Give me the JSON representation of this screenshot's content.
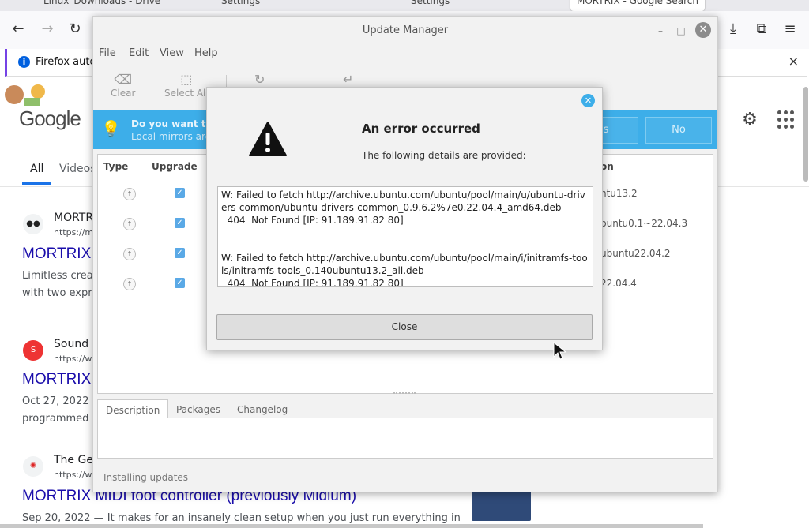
{
  "firefox": {
    "tabs": [
      "Linux_Downloads - Drive",
      "Settings",
      "Settings",
      "MORTRIX - Google Search"
    ],
    "notice_text": "Firefox auto",
    "notice_close": "×"
  },
  "google": {
    "logo": "Google",
    "tab_all": "All",
    "tab_videos": "Videos",
    "results": [
      {
        "site": "MORTR",
        "url": "https://mo",
        "title": "MORTRIX",
        "snippet1": "Limitless creat",
        "snippet2": "with two expre"
      },
      {
        "site": "Sound O",
        "url": "https://ww",
        "title": "MORTRIX",
        "snippet1": "Oct 27, 2022 -",
        "snippet2": "programmed a"
      },
      {
        "site": "The Gea",
        "url": "https://ww",
        "title": "MORTRIX MIDI foot controller (previously Midium)",
        "snippet1": "Sep 20, 2022 — It makes for an insanely clean setup when you just run everything in"
      }
    ]
  },
  "update_manager": {
    "title": "Update Manager",
    "menu": [
      "File",
      "Edit",
      "View",
      "Help"
    ],
    "toolbar": {
      "clear": "Clear",
      "select_all": "Select All"
    },
    "banner": {
      "line1": "Do you want to",
      "line2": "Local mirrors are",
      "yes": "es",
      "no": "No"
    },
    "columns": {
      "type": "Type",
      "upgrade": "Upgrade",
      "version": "on"
    },
    "versions": [
      "ntu13.2",
      "buntu0.1~22.04.3",
      "ubuntu22.04.2",
      "22.04.4"
    ],
    "tabs": [
      "Description",
      "Packages",
      "Changelog"
    ],
    "status": "Installing updates"
  },
  "error_dialog": {
    "title": "An error occurred",
    "subtitle": "The following details are provided:",
    "message1": "W: Failed to fetch http://archive.ubuntu.com/ubuntu/pool/main/u/ubuntu-drivers-common/ubuntu-drivers-common_0.9.6.2%7e0.22.04.4_amd64.deb",
    "message1b": "  404  Not Found [IP: 91.189.91.82 80]",
    "message2": "W: Failed to fetch http://archive.ubuntu.com/ubuntu/pool/main/i/initramfs-tools/initramfs-tools_0.140ubuntu13.2_all.deb",
    "message2b": "  404  Not Found [IP: 91.189.91.82 80]",
    "close_label": "Close"
  },
  "colors": {
    "accent": "#3daee9",
    "link": "#1a0dab"
  }
}
